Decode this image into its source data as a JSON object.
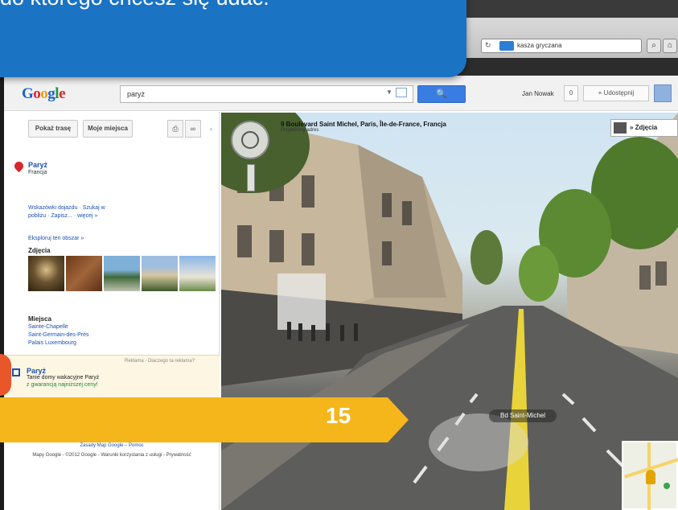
{
  "callout": {
    "text": "e, do którego chcesz się udać."
  },
  "browser": {
    "address": "kasza gryczana"
  },
  "header": {
    "logo": [
      "G",
      "o",
      "o",
      "g",
      "l",
      "e"
    ],
    "search_value": "paryż",
    "search_button": "🔍",
    "user_name": "Jan Nowak",
    "notification_count": "0",
    "share_label": "+ Udostępnij"
  },
  "left_panel": {
    "buttons": [
      "Pokaż trasę",
      "Moje miejsca"
    ],
    "place_title": "Paryż",
    "place_country": "Francja",
    "links_line1": "Wskazówki dojazdu · Szukaj w",
    "links_line2": "pobliżu · Zapisz... · więcej »",
    "explore_link": "Eksploruj ten obszar »",
    "photos_heading": "Zdjęcia",
    "places_heading": "Miejsca",
    "places": [
      "Sainte-Chapelle",
      "Saint-Germain-des-Prés",
      "Palais Luxembourg"
    ],
    "ad": {
      "label": "Reklama · Dlaczego ta reklama?",
      "title": "Paryż",
      "text": "Tanie domy wakacyjne Paryż",
      "text2": "z gwarancją najniższej ceny!"
    },
    "footer1": "Zasady Map Google – Pomoc",
    "footer2": "Mapy Google - ©2012 Google - Warunki korzystania z usługi - Prywatność"
  },
  "street_view": {
    "address": "9 Boulevard Saint Michel, Paris, Île-de-France, Francja",
    "address_sub": "Przybliżony adres",
    "photos_label": "» Zdjęcia",
    "street_label": "Bd Saint-Michel"
  },
  "banner": {
    "number": "15"
  },
  "colors": {
    "callout_blue": "#1a73c3",
    "banner_yellow": "#f4b61a",
    "link_blue": "#1a4fb5"
  }
}
